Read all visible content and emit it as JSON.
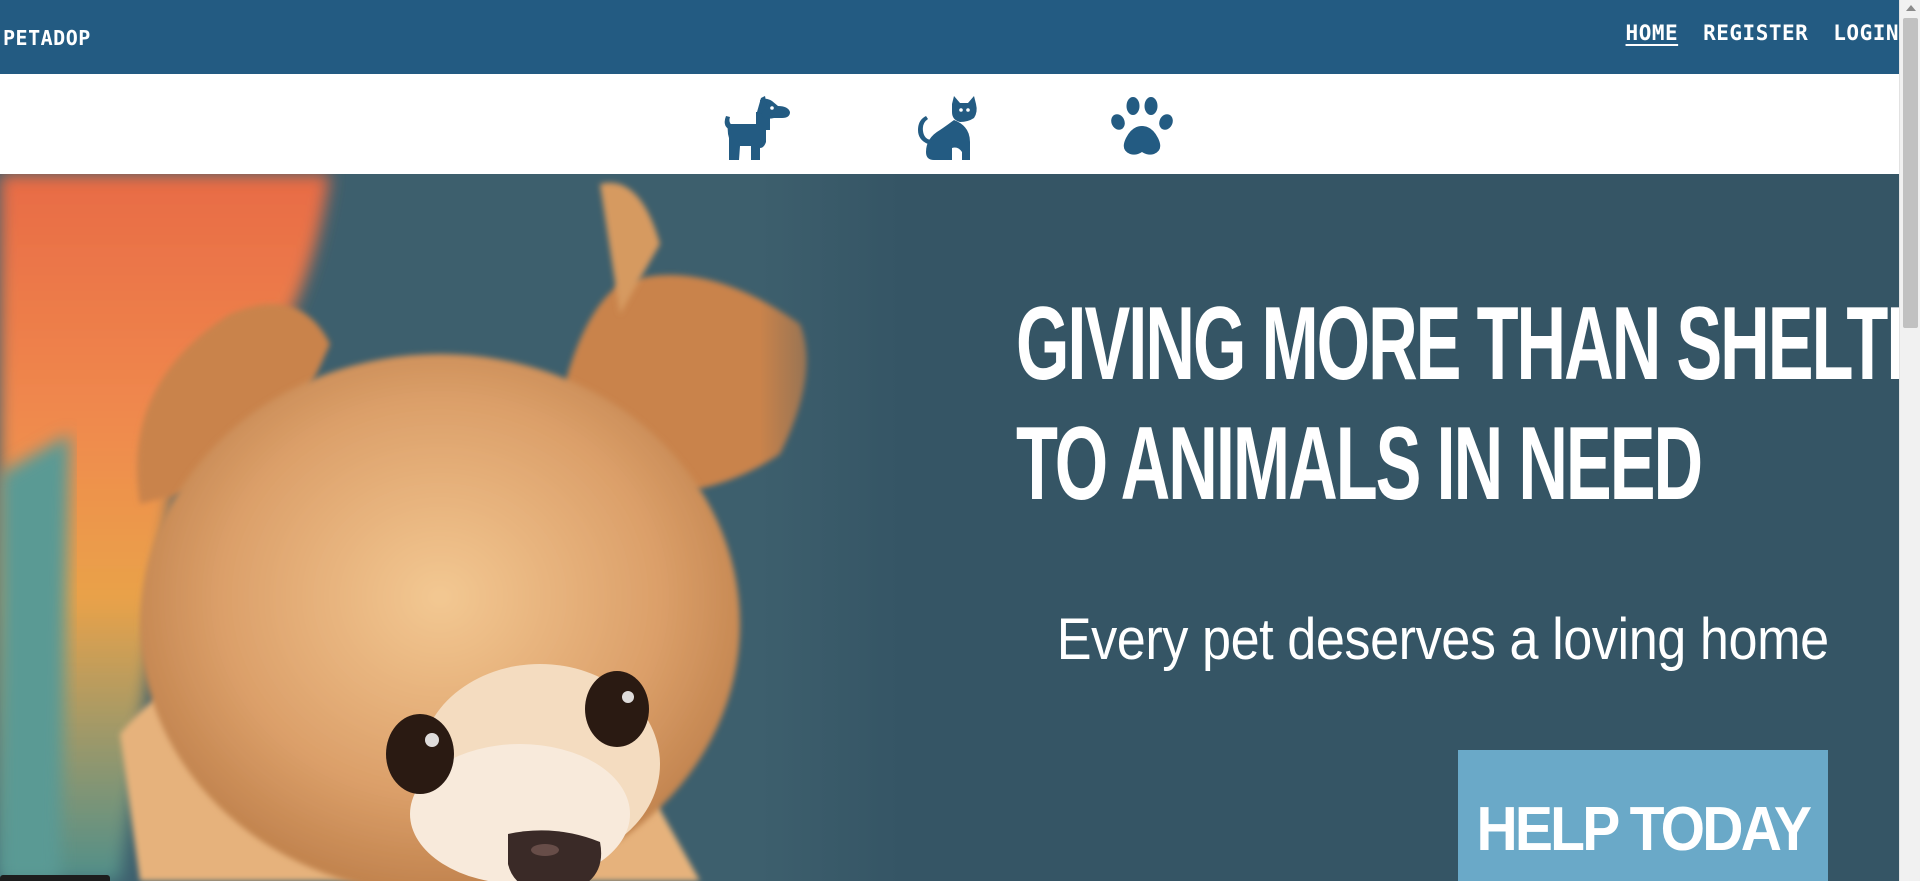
{
  "navbar": {
    "brand": "PETADOP",
    "links": [
      {
        "label": "HOME",
        "active": true
      },
      {
        "label": "REGISTER",
        "active": false
      },
      {
        "label": "LOGIN",
        "active": false
      }
    ],
    "background": "#235b82"
  },
  "categories": [
    {
      "name": "dog",
      "icon": "dog-icon"
    },
    {
      "name": "cat",
      "icon": "cat-icon"
    },
    {
      "name": "other",
      "icon": "paw-icon"
    }
  ],
  "hero": {
    "headline_line1": "GIVING MORE THAN SHELTER",
    "registered_mark": "®",
    "headline_line2": "TO ANIMALS IN NEED",
    "tagline": "Every pet deserves a loving home",
    "cta_label": "HELP TODAY",
    "background": "#355565",
    "cta_color": "#6aa9c8",
    "image": "dog-photo"
  },
  "colors": {
    "icon": "#235b82"
  }
}
